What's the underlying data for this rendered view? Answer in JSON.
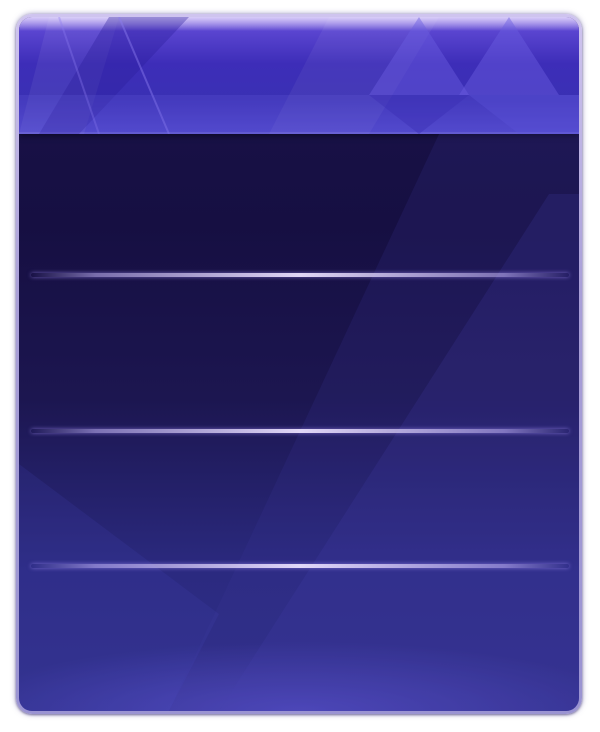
{
  "panel": {
    "title": "",
    "rows": [
      {
        "label": "",
        "value": ""
      },
      {
        "label": "",
        "value": ""
      },
      {
        "label": "",
        "value": ""
      },
      {
        "label": "",
        "value": ""
      }
    ]
  },
  "colors": {
    "frame": "#a99fd8",
    "header_top": "#a68cf0",
    "header_main": "#3d2db8",
    "body_top": "#1a134a",
    "body_bottom": "#302f88",
    "divider": "#e6dcff"
  }
}
